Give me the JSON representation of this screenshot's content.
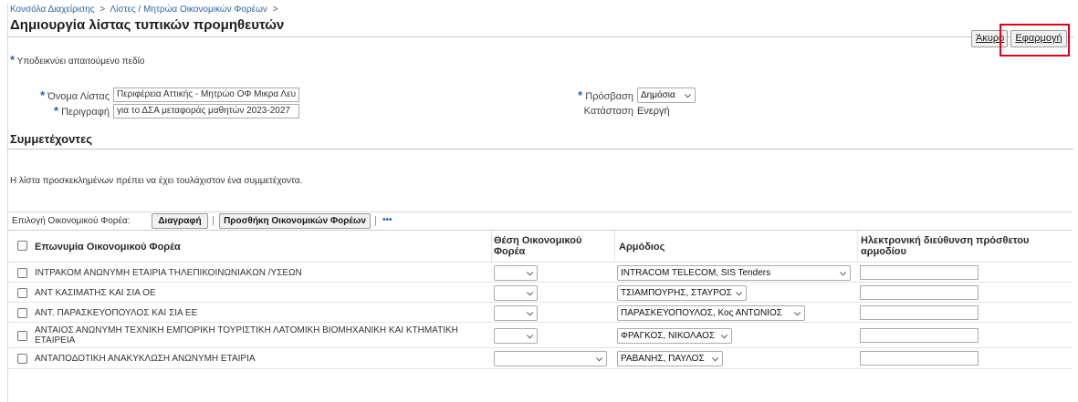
{
  "breadcrumbs": [
    "Κονσόλα Διαχείρισης",
    "Λίστες / Μητρώα Οικονομικών Φορέων"
  ],
  "breadcrumb_sep": ">",
  "page_title": "Δημιουργία λίστας τυπικών προμηθευτών",
  "buttons": {
    "cancel": "Άκυρο",
    "apply": "Εφαρμογή"
  },
  "required_hint": "Υποδεικνύει απαιτούμενο πεδίο",
  "form": {
    "list_name_label": "Όνομα Λίστας",
    "list_name_value": "Περιφέρεια Αττικής - Μητρώο ΟΦ Μικρα Λευ",
    "description_label": "Περιγραφή",
    "description_value": "για το ΔΣΑ μεταφοράς μαθητών 2023-2027",
    "access_label": "Πρόσβαση",
    "access_value": "Δημόσια",
    "status_label": "Κατάσταση",
    "status_value": "Ενεργή"
  },
  "participants": {
    "heading": "Συμμετέχοντες",
    "note": "Η λίστα προσκεκλημένων πρέπει να έχει τουλάχιστον ένα συμμετέχοντα.",
    "select_label": "Επιλογή Οικονομικού Φορέα:",
    "delete_button": "Διαγραφή",
    "add_button": "Προσθήκη Οικονομικών Φορέων",
    "more": "•••",
    "columns": {
      "name": "Επωνυμία Οικονομικού Φορέα",
      "role": "Θέση Οικονομικού Φορέα",
      "contact": "Αρμόδιος",
      "email": "Ηλεκτρονική διεύθυνση πρόσθετου αρμοδίου"
    },
    "rows": [
      {
        "name": "ΙΝΤΡΑΚΟΜ ΑΝΩΝΥΜΗ ΕΤΑΙΡΙΑ ΤΗΛΕΠΙΚΟΙΝΩΝΙΑΚΩΝ /ΥΣΕΩΝ",
        "role": "",
        "contact": "INTRACOM TELECOM, SIS Tenders",
        "email": ""
      },
      {
        "name": "ΑΝΤ ΚΑΣΙΜΑΤΗΣ ΚΑΙ ΣΙΑ ΟΕ",
        "role": "",
        "contact": "ΤΣΙΑΜΠΟΥΡΗΣ, ΣΤΑΥΡΟΣ",
        "email": ""
      },
      {
        "name": "ΑΝΤ. ΠΑΡΑΣΚΕΥΟΠΟΥΛΟΣ ΚΑΙ ΣΙΑ ΕΕ",
        "role": "",
        "contact": "ΠΑΡΑΣΚΕΥΟΠΟΥΛΟΣ, Κος ΑΝΤΩΝΙΟΣ",
        "email": ""
      },
      {
        "name": "ΑΝΤΑΙΟΣ ΑΝΩΝΥΜΗ ΤΕΧΝΙΚΗ ΕΜΠΟΡΙΚΗ ΤΟΥΡΙΣΤΙΚΗ ΛΑΤΟΜΙΚΗ ΒΙΟΜΗΧΑΝΙΚΗ ΚΑΙ ΚΤΗΜΑΤΙΚΗ ΕΤΑΙΡΕΙΑ",
        "role": "",
        "contact": "ΦΡΑΓΚΟΣ, ΝΙΚΟΛΑΟΣ",
        "email": ""
      },
      {
        "name": "ΑΝΤΑΠΟΔΟΤΙΚΗ ΑΝΑΚΥΚΛΩΣΗ ΑΝΩΝΥΜΗ ΕΤΑΙΡΙΑ",
        "role": "",
        "contact": "ΡΑΒΑΝΗΣ, ΠΑΥΛΟΣ",
        "email": ""
      }
    ]
  },
  "colors": {
    "link": "#2a64a8",
    "highlight": "#e0001a"
  }
}
